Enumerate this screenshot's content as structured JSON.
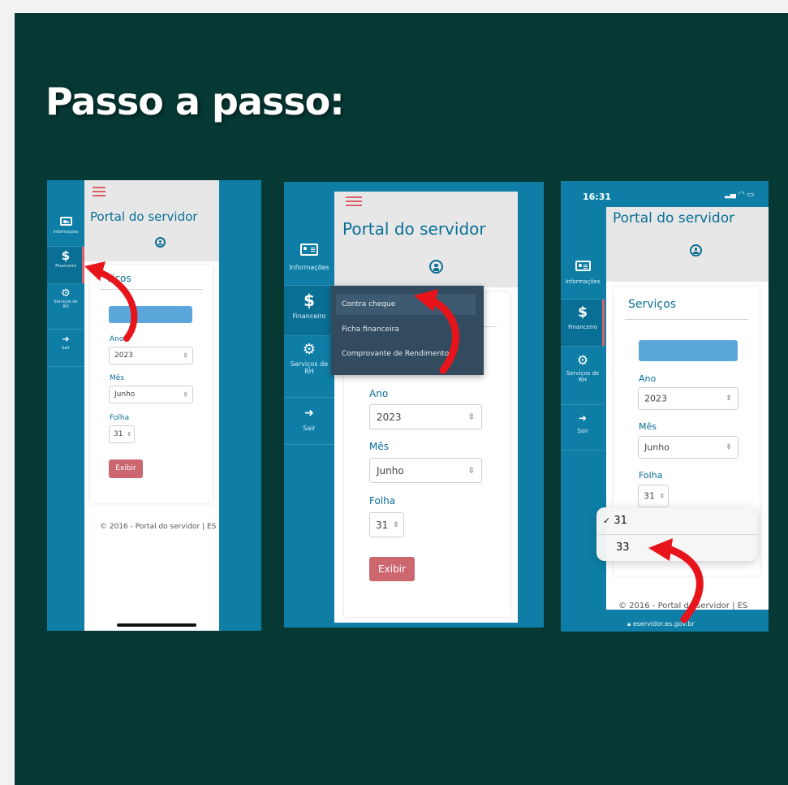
{
  "heading": "Passo a passo:",
  "colors": {
    "background": "#063834",
    "sidebar": "#0e7ea7",
    "accent_red": "#d9606b",
    "arrow_red": "#e8141b",
    "link_blue": "#0a6f95"
  },
  "portal_title": "Portal do servidor",
  "sidebar": {
    "informacoes": "Informações",
    "financeiro": "Financeiro",
    "servicos_rh": "Serviços de RH",
    "sair": "Sair",
    "icons": [
      "id-card-icon",
      "dollar-icon",
      "gears-icon",
      "sign-out-icon"
    ]
  },
  "card": {
    "title": "Serviços",
    "title_partial": "viços",
    "ano_label": "Ano",
    "ano_value": "2023",
    "mes_label": "Mês",
    "mes_value": "Junho",
    "folha_label": "Folha",
    "folha_value": "31",
    "exibir": "Exibir"
  },
  "footer": "© 2016 - Portal do servidor | ES",
  "financeiro_menu": [
    "Contra cheque",
    "Ficha financeira",
    "Comprovante de Rendimentos"
  ],
  "picker_options": [
    {
      "label": "31",
      "checked": true
    },
    {
      "label": "33",
      "checked": false
    }
  ],
  "phone3": {
    "time": "16:31",
    "url": "eservidor.es.gov.br"
  }
}
